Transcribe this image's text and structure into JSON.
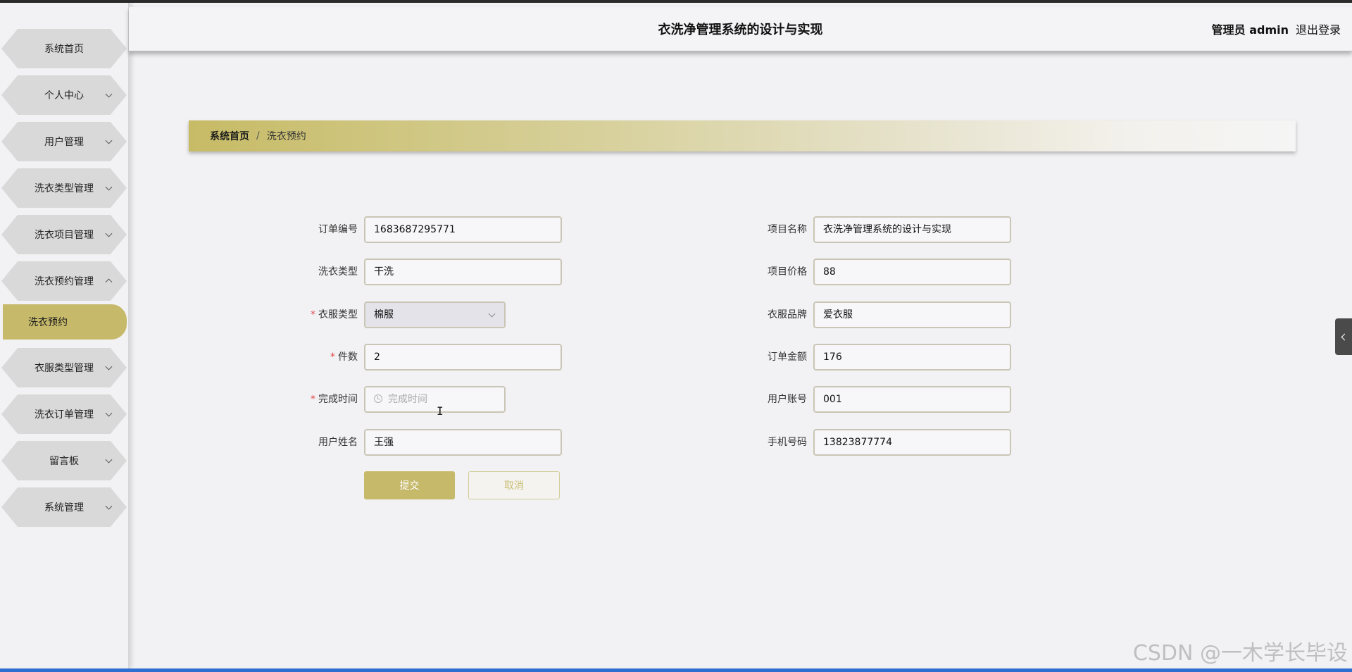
{
  "header": {
    "title": "衣洗净管理系统的设计与实现",
    "user": "管理员 admin",
    "logout": "退出登录"
  },
  "sidebar": {
    "items": [
      {
        "label": "系统首页",
        "expandable": false
      },
      {
        "label": "个人中心",
        "expandable": true
      },
      {
        "label": "用户管理",
        "expandable": true
      },
      {
        "label": "洗衣类型管理",
        "expandable": true
      },
      {
        "label": "洗衣项目管理",
        "expandable": true
      },
      {
        "label": "洗衣预约管理",
        "expandable": true,
        "expanded": true
      },
      {
        "label": "衣服类型管理",
        "expandable": true
      },
      {
        "label": "洗衣订单管理",
        "expandable": true
      },
      {
        "label": "留言板",
        "expandable": true
      },
      {
        "label": "系统管理",
        "expandable": true
      }
    ],
    "active_sub": "洗衣预约"
  },
  "breadcrumb": {
    "home": "系统首页",
    "separator": "/",
    "current": "洗衣预约"
  },
  "form": {
    "order_no": {
      "label": "订单编号",
      "value": "1683687295771"
    },
    "laundry_type": {
      "label": "洗衣类型",
      "value": "干洗"
    },
    "clothes_type": {
      "label": "衣服类型",
      "value": "棉服",
      "required": true
    },
    "count": {
      "label": "件数",
      "value": "2",
      "required": true
    },
    "finish_time": {
      "label": "完成时间",
      "placeholder": "完成时间",
      "required": true
    },
    "user_name": {
      "label": "用户姓名",
      "value": "王强"
    },
    "project_name": {
      "label": "项目名称",
      "value": "衣洗净管理系统的设计与实现"
    },
    "project_price": {
      "label": "项目价格",
      "value": "88"
    },
    "clothes_brand": {
      "label": "衣服品牌",
      "value": "爱衣服"
    },
    "order_amount": {
      "label": "订单金额",
      "value": "176"
    },
    "user_account": {
      "label": "用户账号",
      "value": "001"
    },
    "phone": {
      "label": "手机号码",
      "value": "13823877774"
    },
    "required_mark": "*",
    "submit": "提交",
    "cancel": "取消"
  },
  "watermark": "CSDN @一木学长毕设",
  "colors": {
    "accent": "#c6b96a",
    "background": "#f2f1f3",
    "required": "#e04b4b"
  }
}
